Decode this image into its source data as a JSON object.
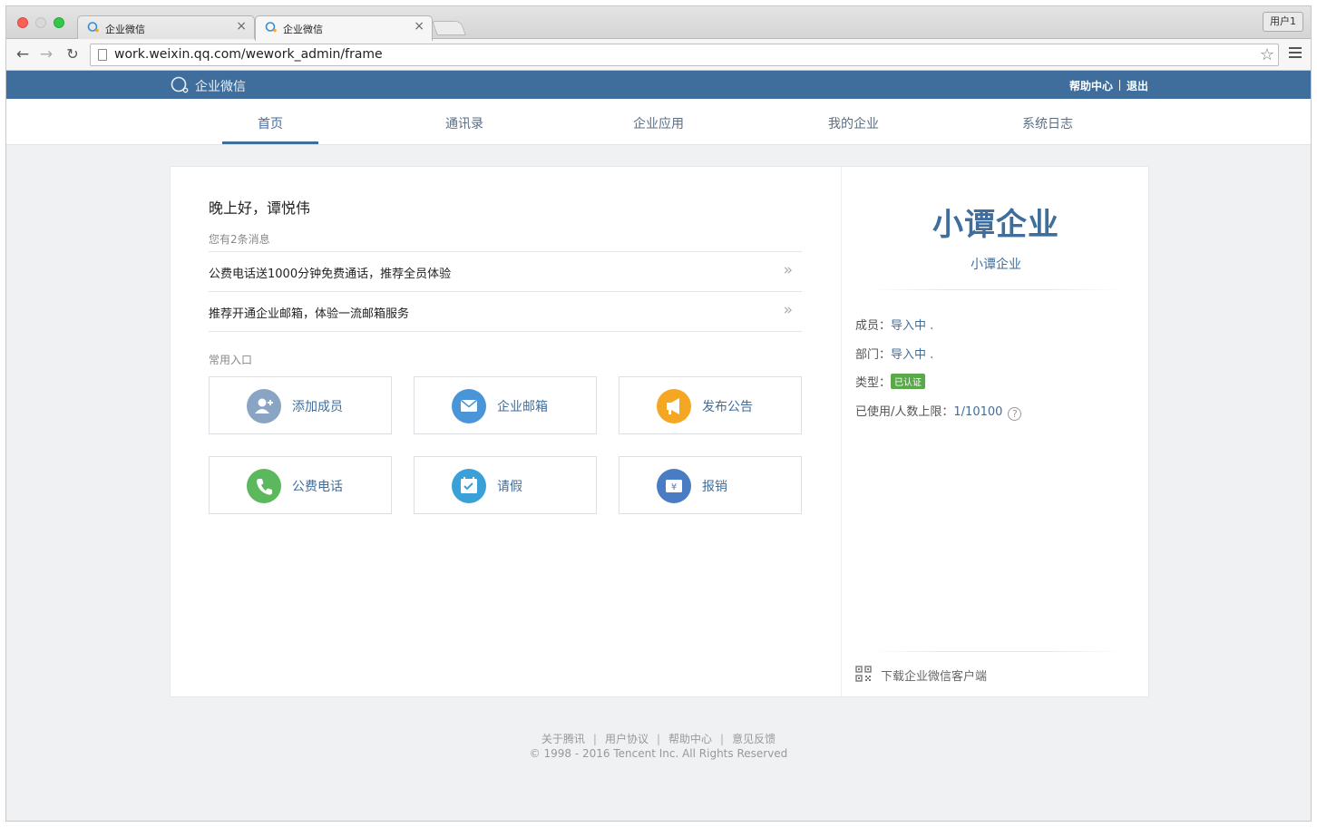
{
  "browser": {
    "tabs": [
      {
        "title": "企业微信",
        "close": "×"
      },
      {
        "title": "企业微信",
        "close": "×"
      }
    ],
    "user_label": "用户1",
    "url": "work.weixin.qq.com/wework_admin/frame"
  },
  "header": {
    "logo_text": "企业微信",
    "help_link": "帮助中心",
    "logout_link": "退出"
  },
  "nav": {
    "items": [
      "首页",
      "通讯录",
      "企业应用",
      "我的企业",
      "系统日志"
    ],
    "active": "首页"
  },
  "main": {
    "greeting": "晚上好，谭悦伟",
    "message_count": "您有2条消息",
    "messages": [
      {
        "text": "公费电话送1000分钟免费通话，推荐全员体验",
        "arrow": "»"
      },
      {
        "text": "推荐开通企业邮箱，体验一流邮箱服务",
        "arrow": "»"
      }
    ],
    "shortcut_title": "常用入口",
    "shortcuts": [
      {
        "label": "添加成员",
        "icon": "add-member-icon",
        "color": "#8aa4c4"
      },
      {
        "label": "企业邮箱",
        "icon": "mail-icon",
        "color": "#4a94d8"
      },
      {
        "label": "发布公告",
        "icon": "megaphone-icon",
        "color": "#f5a623"
      },
      {
        "label": "公费电话",
        "icon": "phone-icon",
        "color": "#5cb85c"
      },
      {
        "label": "请假",
        "icon": "calendar-icon",
        "color": "#3aa0d8"
      },
      {
        "label": "报销",
        "icon": "yuan-icon",
        "color": "#4a7cc4"
      }
    ]
  },
  "company": {
    "name_large": "小谭企业",
    "name_small": "小谭企业",
    "members_label": "成员：",
    "members_value": "导入中 .",
    "departments_label": "部门：",
    "departments_value": "导入中 .",
    "type_label": "类型：",
    "type_badge": "已认证",
    "usage_label": "已使用/人数上限：",
    "usage_value": "1/10100",
    "help_symbol": "?",
    "download_text": "下载企业微信客户端"
  },
  "footer": {
    "links": [
      "关于腾讯",
      "用户协议",
      "帮助中心",
      "意见反馈"
    ],
    "separator": "|",
    "copyright": "© 1998 - 2016 Tencent Inc. All Rights Reserved"
  },
  "colors": {
    "brand": "#406e9c",
    "verified": "#5aa84a"
  }
}
